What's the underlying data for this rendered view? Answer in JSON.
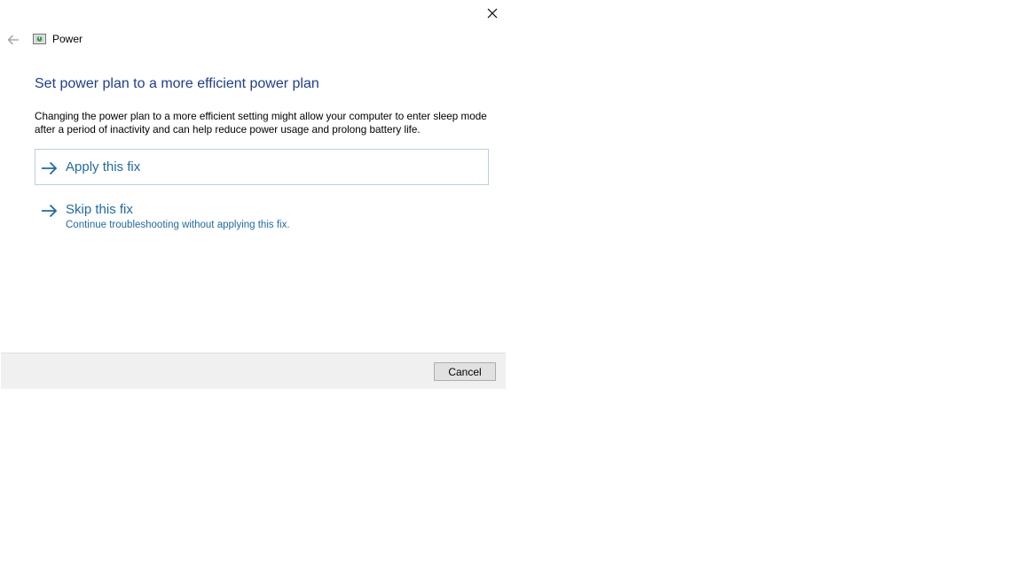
{
  "window": {
    "title": "Power",
    "close_icon": "close-icon",
    "back_icon": "back-arrow-icon",
    "app_icon": "power-troubleshooter-icon"
  },
  "main": {
    "heading": "Set power plan to a more efficient power plan",
    "description": "Changing the power plan to a more efficient setting might allow your computer to enter sleep mode after a period of inactivity and can help reduce power usage and prolong battery life.",
    "options": [
      {
        "title": "Apply this fix",
        "subtitle": ""
      },
      {
        "title": "Skip this fix",
        "subtitle": "Continue troubleshooting without applying this fix."
      }
    ]
  },
  "footer": {
    "cancel_label": "Cancel"
  },
  "colors": {
    "heading": "#1e3f8b",
    "link": "#1f6aa5",
    "selected_border": "#b7cfe6",
    "footer_bg": "#f0f0f0"
  }
}
